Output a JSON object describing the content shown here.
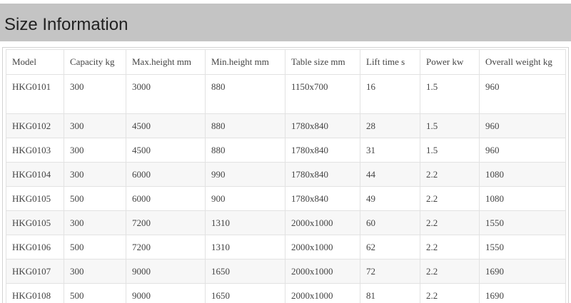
{
  "header": {
    "title": "Size Information"
  },
  "table": {
    "columns": [
      "Model",
      "Capacity kg",
      "Max.height mm",
      "Min.height mm",
      "Table size mm",
      "Lift time s",
      "Power kw",
      "Overall weight kg"
    ],
    "rows": [
      [
        "HKG0101",
        "300",
        "3000",
        "880",
        "1150x700",
        "16",
        "1.5",
        "960"
      ],
      [
        "HKG0102",
        "300",
        "4500",
        "880",
        "1780x840",
        "28",
        "1.5",
        "960"
      ],
      [
        "HKG0103",
        "300",
        "4500",
        "880",
        "1780x840",
        "31",
        "1.5",
        "960"
      ],
      [
        "HKG0104",
        "300",
        "6000",
        "990",
        "1780x840",
        "44",
        "2.2",
        "1080"
      ],
      [
        "HKG0105",
        "500",
        "6000",
        "900",
        "1780x840",
        "49",
        "2.2",
        "1080"
      ],
      [
        "HKG0105",
        "300",
        "7200",
        "1310",
        "2000x1000",
        "60",
        "2.2",
        "1550"
      ],
      [
        "HKG0106",
        "500",
        "7200",
        "1310",
        "2000x1000",
        "62",
        "2.2",
        "1550"
      ],
      [
        "HKG0107",
        "300",
        "9000",
        "1650",
        "2000x1000",
        "72",
        "2.2",
        "1690"
      ],
      [
        "HKG0108",
        "500",
        "9000",
        "1650",
        "2000x1000",
        "81",
        "2.2",
        "1690"
      ]
    ]
  },
  "colors": {
    "header_bg": "#c4c4c4",
    "title_text": "#222222",
    "table_text": "#444444",
    "row_stripe": "#f7f7f7",
    "grid_line": "#e2e2e2"
  }
}
